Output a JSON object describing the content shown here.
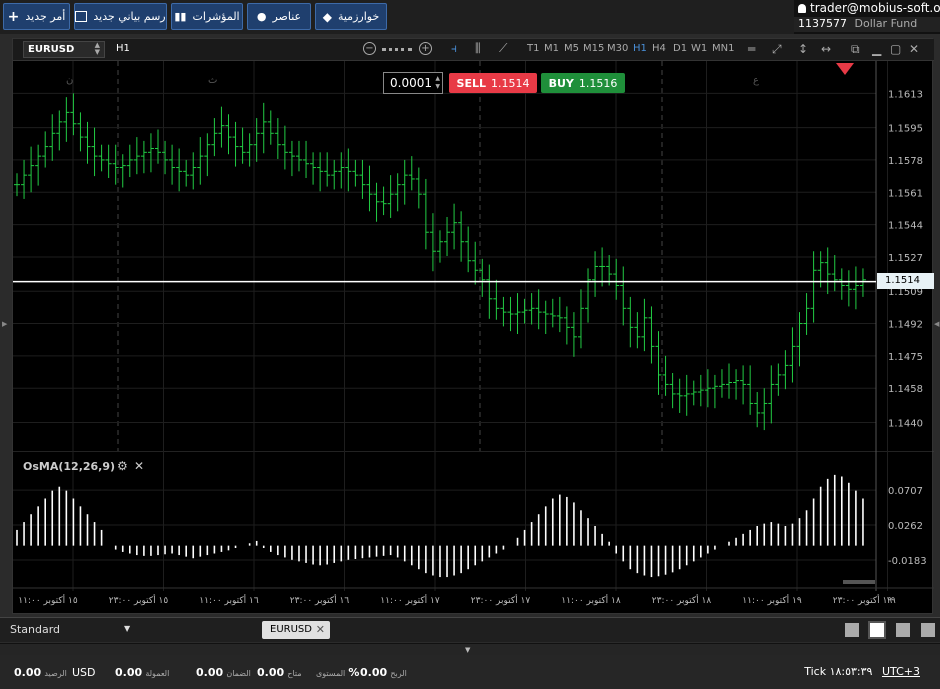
{
  "toolbar": {
    "new_order": "أمر جديد",
    "new_chart": "رسم بياني جديد",
    "indicators": "المؤشرات",
    "elements": "عناصر",
    "algorithms": "خوارزمية"
  },
  "account": {
    "user": "trader@mobius-soft.org",
    "number": "1137577",
    "fund": "Dollar Fund"
  },
  "chart": {
    "symbol": "EURUSD",
    "timeframe": "H1",
    "timeframes": [
      "T1",
      "M1",
      "M5",
      "M15",
      "M30",
      "H1",
      "H4",
      "D1",
      "W1",
      "MN1"
    ],
    "active_timeframe": "H1",
    "lot": "0.0001",
    "sell_label": "SELL",
    "sell_price": "1.1514",
    "buy_label": "BUY",
    "buy_price": "1.1516",
    "current_price_tag": "1.1514",
    "session_marks": [
      "ن",
      "ث",
      "ع"
    ],
    "colors": {
      "sell": "#e83a46",
      "buy": "#1f8f3a",
      "candles": "#22cc44",
      "histogram": "#ffffff",
      "accent": "#4a90d9"
    }
  },
  "indicator": {
    "label": "OsMA(12,26,9)"
  },
  "chart_data": [
    {
      "type": "line",
      "name": "EURUSD H1",
      "y_ticks": [
        "1.1613",
        "1.1595",
        "1.1578",
        "1.1561",
        "1.1544",
        "1.1527",
        "1.1509",
        "1.1492",
        "1.1475",
        "1.1458",
        "1.1440"
      ],
      "ylim": [
        1.1425,
        1.163
      ],
      "x_ticks": [
        "١٥ أكتوبر ١١:٠٠",
        "١٥ أكتوبر ٢٣:٠٠",
        "١٦ أكتوبر ١١:٠٠",
        "١٦ أكتوبر ٢٣:٠٠",
        "١٧ أكتوبر ١١:٠٠",
        "١٧ أكتوبر ٢٣:٠٠",
        "١٨ أكتوبر ١١:٠٠",
        "١٨ أكتوبر ٢٣:٠٠",
        "١٩ أكتوبر ١١:٠٠",
        "١٩ أكتوبر ٢٣:٠٠"
      ],
      "last_price": 1.1514,
      "close": [
        1.1565,
        1.157,
        1.1575,
        1.158,
        1.1585,
        1.1592,
        1.1598,
        1.1603,
        1.1597,
        1.159,
        1.1585,
        1.158,
        1.1578,
        1.1576,
        1.1574,
        1.1575,
        1.1578,
        1.158,
        1.1582,
        1.1584,
        1.1582,
        1.1578,
        1.1574,
        1.1572,
        1.157,
        1.1574,
        1.158,
        1.1586,
        1.1592,
        1.1596,
        1.159,
        1.1585,
        1.1582,
        1.1586,
        1.1592,
        1.1598,
        1.1592,
        1.1586,
        1.1582,
        1.158,
        1.1578,
        1.1576,
        1.1574,
        1.1572,
        1.157,
        1.1572,
        1.1574,
        1.1572,
        1.157,
        1.1565,
        1.156,
        1.1556,
        1.1555,
        1.156,
        1.1565,
        1.157,
        1.1568,
        1.156,
        1.154,
        1.153,
        1.1535,
        1.154,
        1.1545,
        1.1535,
        1.1525,
        1.152,
        1.1515,
        1.1505,
        1.15,
        1.1498,
        1.1497,
        1.1498,
        1.1499,
        1.15,
        1.1498,
        1.1497,
        1.1496,
        1.1495,
        1.149,
        1.1485,
        1.15,
        1.1515,
        1.1522,
        1.1522,
        1.1518,
        1.1512,
        1.15,
        1.149,
        1.1485,
        1.1495,
        1.148,
        1.1465,
        1.146,
        1.1455,
        1.1454,
        1.1455,
        1.1456,
        1.1457,
        1.1458,
        1.1459,
        1.146,
        1.1461,
        1.1462,
        1.146,
        1.145,
        1.1445,
        1.145,
        1.146,
        1.1465,
        1.147,
        1.148,
        1.1492,
        1.15,
        1.152,
        1.1524,
        1.1518,
        1.1515,
        1.1512,
        1.151,
        1.1512,
        1.1515
      ]
    },
    {
      "type": "bar",
      "name": "OsMA(12,26,9)",
      "y_ticks": [
        "0.0707",
        "0.0262",
        "-0.0183"
      ],
      "ylim": [
        -0.045,
        0.095
      ],
      "values": [
        0.02,
        0.03,
        0.04,
        0.05,
        0.06,
        0.07,
        0.075,
        0.07,
        0.06,
        0.05,
        0.04,
        0.03,
        0.02,
        0.0,
        -0.005,
        -0.008,
        -0.01,
        -0.012,
        -0.013,
        -0.013,
        -0.012,
        -0.011,
        -0.01,
        -0.012,
        -0.014,
        -0.016,
        -0.014,
        -0.012,
        -0.01,
        -0.008,
        -0.006,
        -0.003,
        0.0,
        0.003,
        0.006,
        -0.003,
        -0.008,
        -0.012,
        -0.015,
        -0.018,
        -0.02,
        -0.022,
        -0.024,
        -0.025,
        -0.024,
        -0.022,
        -0.02,
        -0.018,
        -0.017,
        -0.016,
        -0.015,
        -0.014,
        -0.013,
        -0.012,
        -0.015,
        -0.02,
        -0.025,
        -0.03,
        -0.035,
        -0.038,
        -0.04,
        -0.04,
        -0.038,
        -0.035,
        -0.03,
        -0.025,
        -0.02,
        -0.015,
        -0.01,
        -0.005,
        0.0,
        0.01,
        0.02,
        0.03,
        0.04,
        0.05,
        0.06,
        0.065,
        0.062,
        0.055,
        0.045,
        0.035,
        0.025,
        0.015,
        0.005,
        -0.01,
        -0.02,
        -0.03,
        -0.035,
        -0.038,
        -0.04,
        -0.039,
        -0.037,
        -0.034,
        -0.03,
        -0.025,
        -0.02,
        -0.015,
        -0.01,
        -0.005,
        0.0,
        0.005,
        0.01,
        0.015,
        0.02,
        0.025,
        0.028,
        0.03,
        0.028,
        0.025,
        0.028,
        0.035,
        0.045,
        0.06,
        0.075,
        0.085,
        0.09,
        0.088,
        0.08,
        0.07,
        0.06
      ]
    }
  ],
  "workspace": {
    "name": "Standard",
    "tab": "EURUSD"
  },
  "status": {
    "currency": "USD",
    "balance_label": "الرصيد",
    "balance": "0.00",
    "commission_label": "العمولة",
    "commission": "0.00",
    "margin_label": "الضمان",
    "margin": "0.00",
    "free_label": "متاح",
    "free": "0.00",
    "level_label": "المستوى",
    "level": "%",
    "profit_label": "الربح",
    "profit": "0.00",
    "tick_label": "Tick",
    "time": "١٨:٥٣:٣٩",
    "timezone": "UTC+3"
  }
}
